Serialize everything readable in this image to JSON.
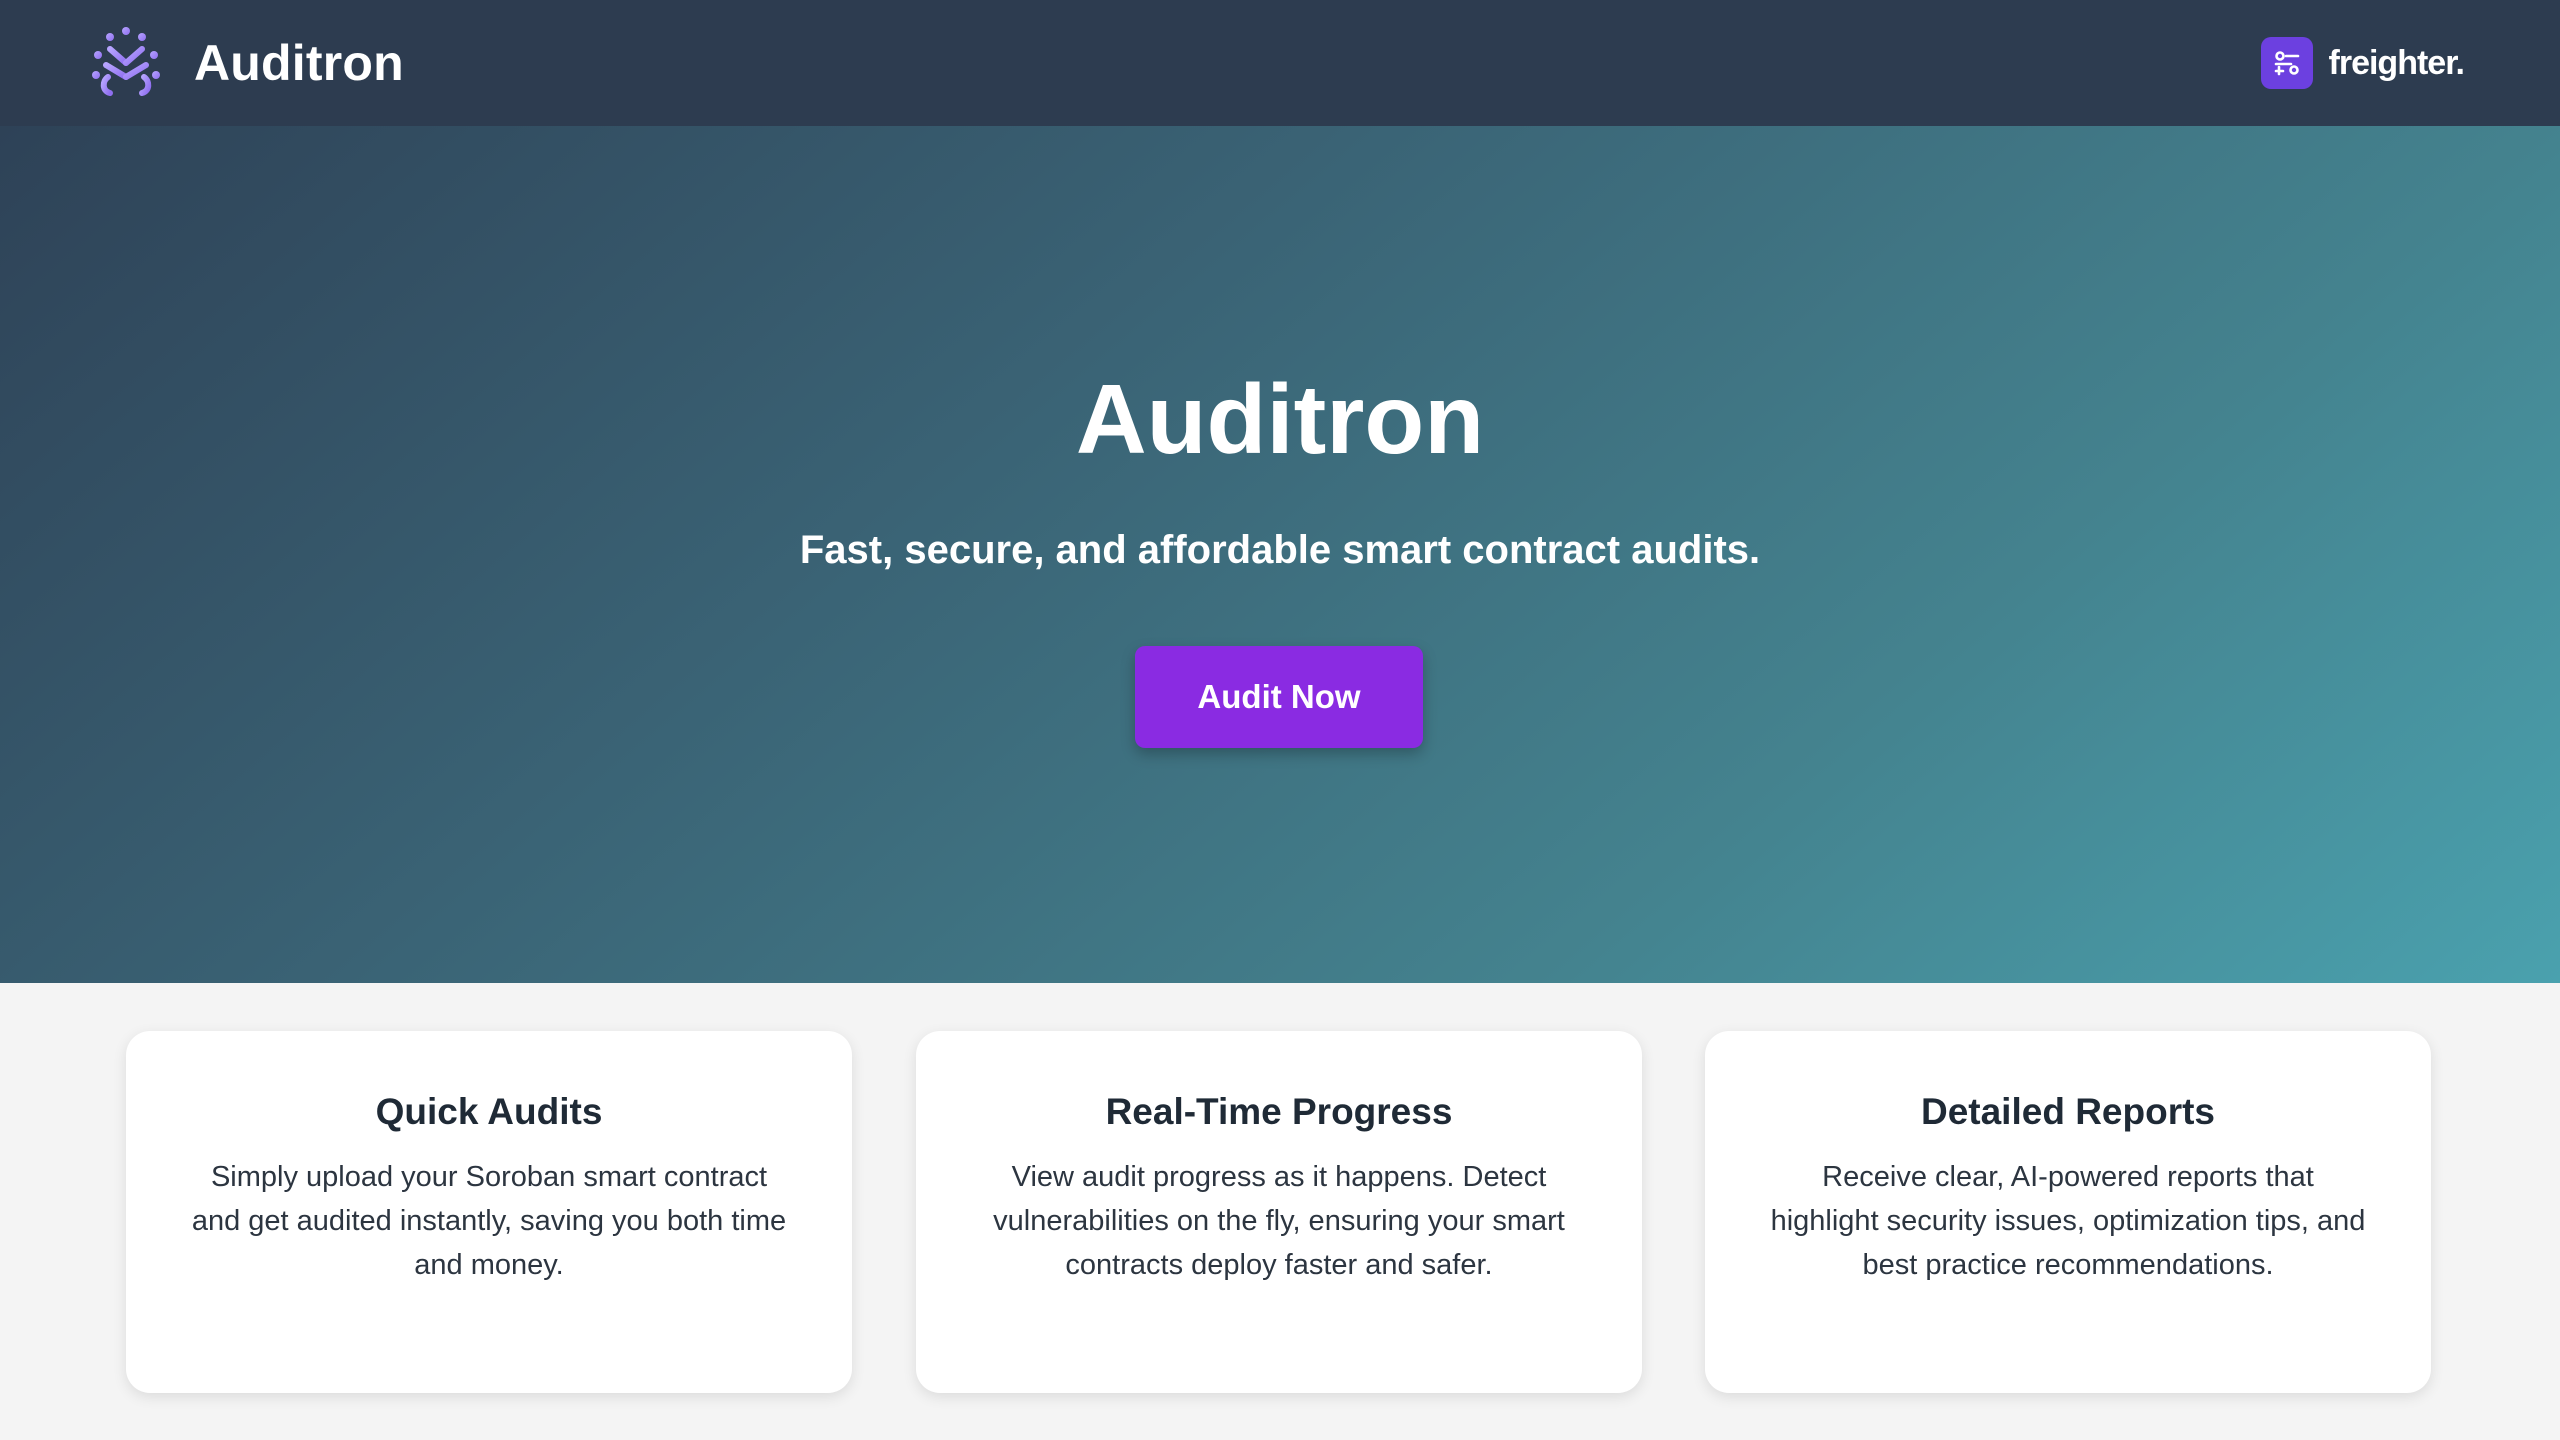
{
  "header": {
    "brand_name": "Auditron",
    "logo_icon": "auditron-logo-icon",
    "wallet": {
      "icon": "freighter-wallet-icon",
      "label": "freighter."
    }
  },
  "hero": {
    "title": "Auditron",
    "subtitle": "Fast, secure, and affordable smart contract audits.",
    "cta_label": "Audit Now"
  },
  "features": [
    {
      "title": "Quick Audits",
      "text": "Simply upload your Soroban smart contract and get audited instantly, saving you both time and money."
    },
    {
      "title": "Real-Time Progress",
      "text": "View audit progress as it happens. Detect vulnerabilities on the fly, ensuring your smart contracts deploy faster and safer."
    },
    {
      "title": "Detailed Reports",
      "text": "Receive clear, AI-powered reports that highlight security issues, optimization tips, and best practice recommendations."
    }
  ],
  "colors": {
    "header_bg": "#2d3c50",
    "accent_purple": "#8a2be2",
    "wallet_purple": "#6c40e0",
    "page_bg": "#f4f4f4"
  }
}
